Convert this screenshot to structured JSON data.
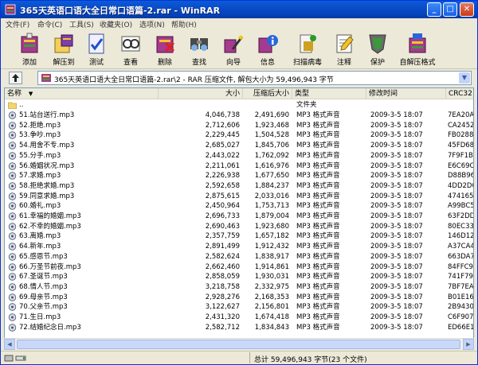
{
  "window": {
    "title": "365天英语口语大全日常口语篇-2.rar - WinRAR"
  },
  "titlebar": {
    "minimize": "_",
    "maximize": "□",
    "close": "✕"
  },
  "menu": [
    "文件(F)",
    "命令(C)",
    "工具(S)",
    "收藏夹(O)",
    "选项(N)",
    "帮助(H)"
  ],
  "toolbar": [
    {
      "label": "添加",
      "icon": "add-archive-icon"
    },
    {
      "label": "解压到",
      "icon": "extract-to-icon"
    },
    {
      "label": "测试",
      "icon": "test-icon"
    },
    {
      "label": "查看",
      "icon": "view-icon"
    },
    {
      "label": "删除",
      "icon": "delete-icon"
    },
    {
      "label": "查找",
      "icon": "find-icon"
    },
    {
      "label": "向导",
      "icon": "wizard-icon"
    },
    {
      "label": "信息",
      "icon": "info-icon"
    },
    {
      "label": "扫描病毒",
      "icon": "virus-scan-icon"
    },
    {
      "label": "注释",
      "icon": "comment-icon"
    },
    {
      "label": "保护",
      "icon": "protect-icon"
    },
    {
      "label": "自解压格式",
      "icon": "sfx-icon"
    }
  ],
  "pathbar": {
    "text": "365天英语口语大全日常口语篇-2.rar\\2 - RAR 压缩文件, 解包大小为 59,496,943 字节"
  },
  "columns": {
    "name": "名称",
    "size": "大小",
    "packed": "压缩后大小",
    "type": "类型",
    "modified": "修改时间",
    "crc": "CRC32"
  },
  "parent_row": {
    "name": "..",
    "type": "文件夹"
  },
  "files": [
    {
      "name": "51.站台送行.mp3",
      "size": "4,046,738",
      "packed": "2,491,690",
      "type": "MP3 格式声音",
      "modified": "2009-3-5 18:07",
      "crc": "7EA20A"
    },
    {
      "name": "52.拒绝.mp3",
      "size": "2,712,606",
      "packed": "1,923,468",
      "type": "MP3 格式声音",
      "modified": "2009-3-5 18:07",
      "crc": "CA2452E"
    },
    {
      "name": "53.争吵.mp3",
      "size": "2,229,445",
      "packed": "1,504,528",
      "type": "MP3 格式声音",
      "modified": "2009-3-5 18:07",
      "crc": "FB0288"
    },
    {
      "name": "54.用舍不专.mp3",
      "size": "2,685,027",
      "packed": "1,845,706",
      "type": "MP3 格式声音",
      "modified": "2009-3-5 18:07",
      "crc": "45FD68"
    },
    {
      "name": "55.分手.mp3",
      "size": "2,443,022",
      "packed": "1,762,092",
      "type": "MP3 格式声音",
      "modified": "2009-3-5 18:07",
      "crc": "7F9F1B"
    },
    {
      "name": "56.婚姻状况.mp3",
      "size": "2,211,061",
      "packed": "1,616,976",
      "type": "MP3 格式声音",
      "modified": "2009-3-5 18:07",
      "crc": "E6C69C"
    },
    {
      "name": "57.求婚.mp3",
      "size": "2,226,938",
      "packed": "1,677,650",
      "type": "MP3 格式声音",
      "modified": "2009-3-5 18:07",
      "crc": "D88B96"
    },
    {
      "name": "58.拒绝求婚.mp3",
      "size": "2,592,658",
      "packed": "1,884,237",
      "type": "MP3 格式声音",
      "modified": "2009-3-5 18:07",
      "crc": "4DD2D0"
    },
    {
      "name": "59.同意求婚.mp3",
      "size": "2,875,615",
      "packed": "2,033,016",
      "type": "MP3 格式声音",
      "modified": "2009-3-5 18:07",
      "crc": "474165"
    },
    {
      "name": "60.婚礼.mp3",
      "size": "2,450,964",
      "packed": "1,753,713",
      "type": "MP3 格式声音",
      "modified": "2009-3-5 18:07",
      "crc": "A99BC5"
    },
    {
      "name": "61.幸福的婚姻.mp3",
      "size": "2,696,733",
      "packed": "1,879,004",
      "type": "MP3 格式声音",
      "modified": "2009-3-5 18:07",
      "crc": "63F2DD"
    },
    {
      "name": "62.不幸的婚姻.mp3",
      "size": "2,690,463",
      "packed": "1,923,680",
      "type": "MP3 格式声音",
      "modified": "2009-3-5 18:07",
      "crc": "80EC33"
    },
    {
      "name": "63.离婚.mp3",
      "size": "2,357,759",
      "packed": "1,657,182",
      "type": "MP3 格式声音",
      "modified": "2009-3-5 18:07",
      "crc": "146D12"
    },
    {
      "name": "64.新年.mp3",
      "size": "2,891,499",
      "packed": "1,912,432",
      "type": "MP3 格式声音",
      "modified": "2009-3-5 18:07",
      "crc": "A37CA4"
    },
    {
      "name": "65.感恩节.mp3",
      "size": "2,582,624",
      "packed": "1,838,917",
      "type": "MP3 格式声音",
      "modified": "2009-3-5 18:07",
      "crc": "663DA7"
    },
    {
      "name": "66.万圣节前夜.mp3",
      "size": "2,662,460",
      "packed": "1,914,861",
      "type": "MP3 格式声音",
      "modified": "2009-3-5 18:07",
      "crc": "84FFC9"
    },
    {
      "name": "67.圣诞节.mp3",
      "size": "2,858,059",
      "packed": "1,930,031",
      "type": "MP3 格式声音",
      "modified": "2009-3-5 18:07",
      "crc": "741F79"
    },
    {
      "name": "68.情人节.mp3",
      "size": "3,218,758",
      "packed": "2,332,975",
      "type": "MP3 格式声音",
      "modified": "2009-3-5 18:07",
      "crc": "7BF7EA"
    },
    {
      "name": "69.母亲节.mp3",
      "size": "2,928,276",
      "packed": "2,168,353",
      "type": "MP3 格式声音",
      "modified": "2009-3-5 18:07",
      "crc": "B01E16"
    },
    {
      "name": "70.父亲节.mp3",
      "size": "3,122,627",
      "packed": "2,156,801",
      "type": "MP3 格式声音",
      "modified": "2009-3-5 18:07",
      "crc": "2B9430"
    },
    {
      "name": "71.生日.mp3",
      "size": "2,431,320",
      "packed": "1,674,418",
      "type": "MP3 格式声音",
      "modified": "2009-3-5 18:07",
      "crc": "C6F907"
    },
    {
      "name": "72.结婚纪念日.mp3",
      "size": "2,582,712",
      "packed": "1,834,843",
      "type": "MP3 格式声音",
      "modified": "2009-3-5 18:07",
      "crc": "ED66E1"
    }
  ],
  "status": {
    "text": "总计 59,496,943 字节(23 个文件)"
  },
  "colors": {
    "titlebar": "#0343b8",
    "chrome": "#ece9d8",
    "border": "#7f9db9"
  }
}
